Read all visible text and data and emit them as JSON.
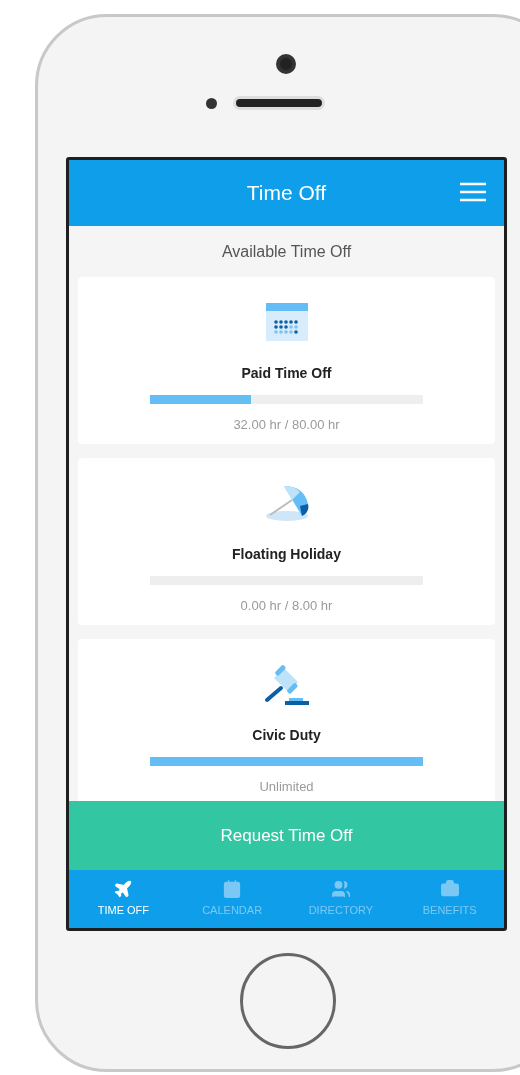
{
  "header": {
    "title": "Time Off"
  },
  "section_title": "Available Time Off",
  "balances": [
    {
      "kind": "calendar",
      "name": "Paid Time Off",
      "level": 0.37,
      "reading": "32.00 hr / 80.00 hr"
    },
    {
      "kind": "umbrella",
      "name": "Floating Holiday",
      "level": 0,
      "reading": "0.00 hr / 8.00 hr"
    },
    {
      "kind": "gavel",
      "name": "Civic Duty",
      "level": 1,
      "reading": "Unlimited"
    }
  ],
  "primary_button": "Request Time Off",
  "tabs": [
    {
      "kind": "plane",
      "label": "TIME OFF",
      "selected": true
    },
    {
      "kind": "calendar",
      "label": "CALENDAR",
      "selected": false
    },
    {
      "kind": "people",
      "label": "DIRECTORY",
      "selected": false
    },
    {
      "kind": "medical",
      "label": "BENEFITS",
      "selected": false
    }
  ]
}
